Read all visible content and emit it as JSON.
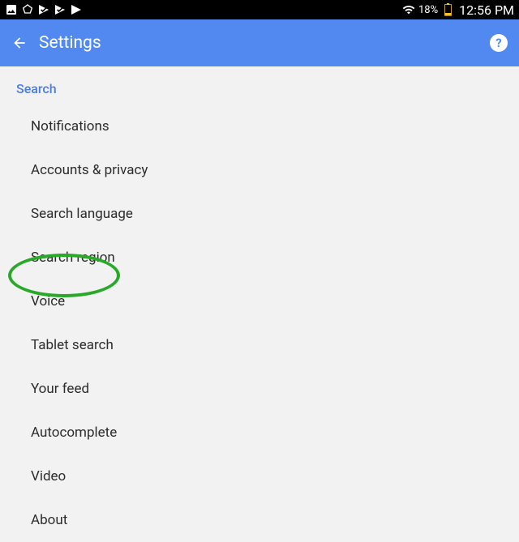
{
  "status_bar": {
    "battery_percent": "18%",
    "clock": "12:56 PM"
  },
  "app_bar": {
    "title": "Settings",
    "help_label": "?"
  },
  "section_header": "Search",
  "items": [
    {
      "label": "Notifications"
    },
    {
      "label": "Accounts & privacy"
    },
    {
      "label": "Search language"
    },
    {
      "label": "Search region"
    },
    {
      "label": "Voice"
    },
    {
      "label": "Tablet search"
    },
    {
      "label": "Your feed"
    },
    {
      "label": "Autocomplete"
    },
    {
      "label": "Video"
    },
    {
      "label": "About"
    }
  ],
  "annotation": {
    "highlighted_item_index": 4,
    "color": "#2aa82a"
  }
}
